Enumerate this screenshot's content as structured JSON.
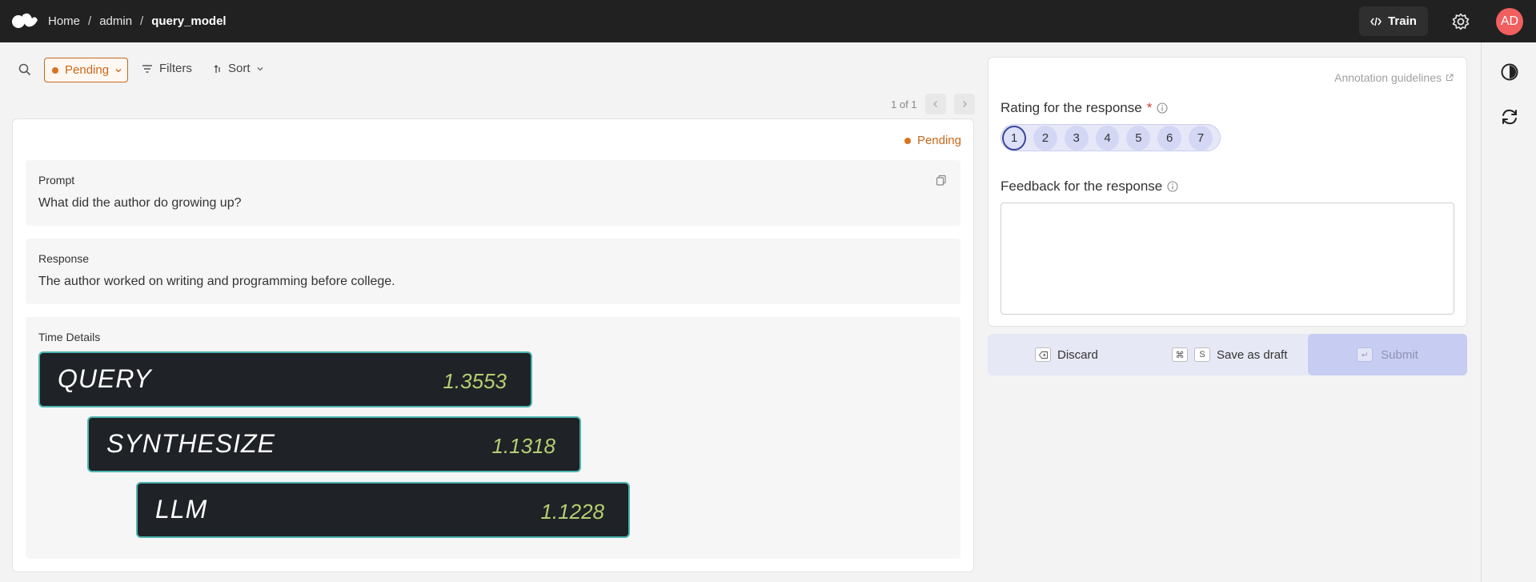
{
  "breadcrumb": {
    "home": "Home",
    "workspace": "admin",
    "dataset": "query_model"
  },
  "topbar": {
    "train_label": "Train",
    "avatar_initials": "AD"
  },
  "toolbar": {
    "status_filter": "Pending",
    "filters_label": "Filters",
    "sort_label": "Sort",
    "pager_text": "1 of 1"
  },
  "record": {
    "status": "Pending",
    "prompt_label": "Prompt",
    "prompt_text": "What did the author do growing up?",
    "response_label": "Response",
    "response_text": "The author worked on writing and programming before college.",
    "time_details_label": "Time Details",
    "timings": [
      {
        "name": "QUERY",
        "value": "1.3553"
      },
      {
        "name": "SYNTHESIZE",
        "value": "1.1318"
      },
      {
        "name": "LLM",
        "value": "1.1228"
      }
    ]
  },
  "panel": {
    "guidelines_label": "Annotation guidelines",
    "rating_label": "Rating for the response",
    "required_mark": "*",
    "rating_options": [
      "1",
      "2",
      "3",
      "4",
      "5",
      "6",
      "7"
    ],
    "rating_selected": "1",
    "feedback_label": "Feedback for the response",
    "feedback_value": ""
  },
  "actions": {
    "discard_label": "Discard",
    "save_draft_label": "Save as draft",
    "save_key_1": "⌘",
    "save_key_2": "S",
    "submit_label": "Submit",
    "submit_key": "↵"
  },
  "colors": {
    "accent_pending": "#c8671a",
    "rating_selected_border": "#3c4799",
    "avatar_bg": "#f15f5f",
    "timing_border": "#4fb5b1",
    "timing_value": "#b6cf72"
  }
}
